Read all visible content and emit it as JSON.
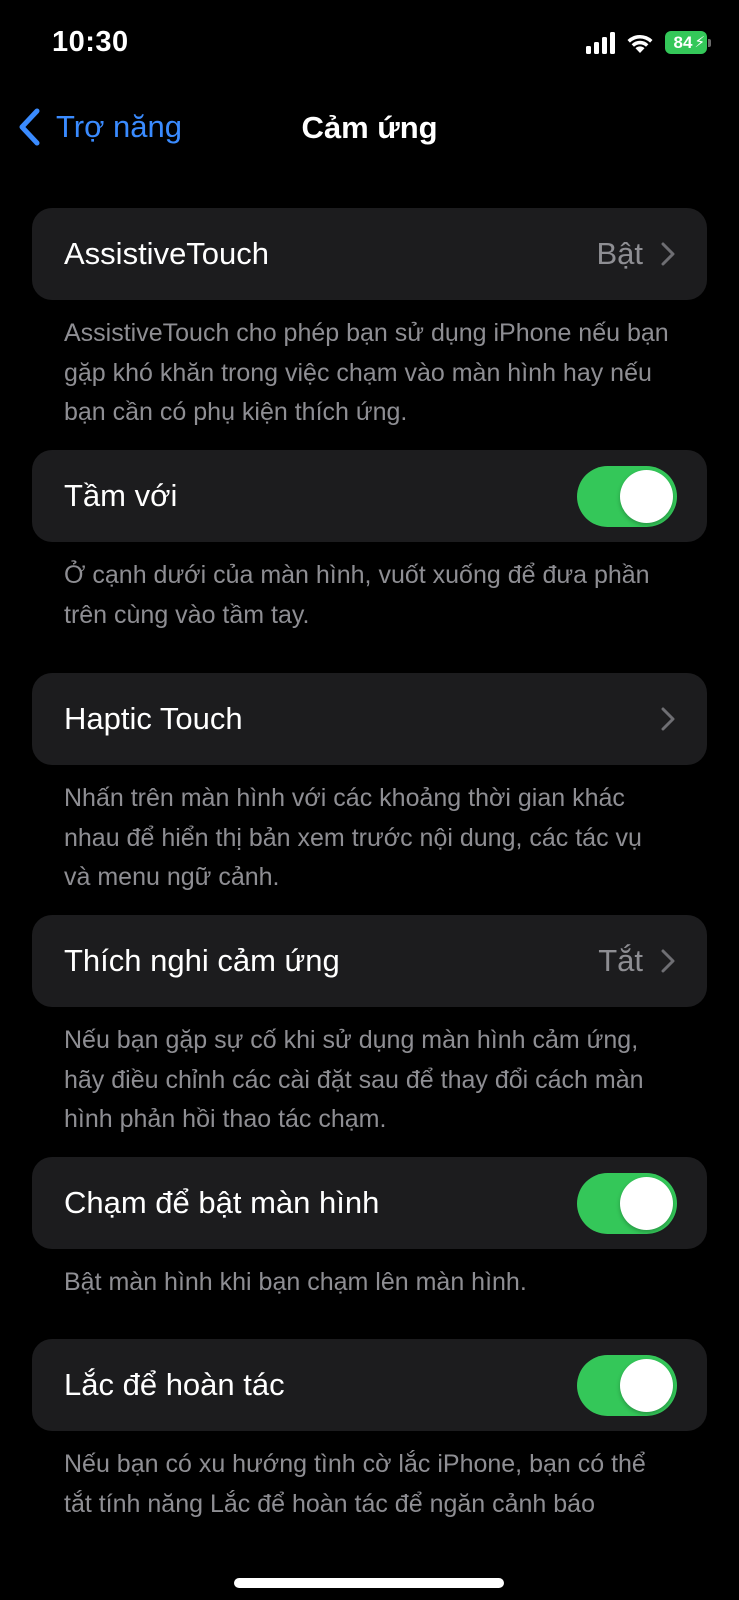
{
  "status_bar": {
    "time": "10:30",
    "battery": "84"
  },
  "nav": {
    "back_label": "Trợ năng",
    "title": "Cảm ứng"
  },
  "colors": {
    "accent": "#3a8bff",
    "toggle_on": "#34c759",
    "cell_bg": "#1c1c1e",
    "secondary_text": "#8e8e93"
  },
  "settings": [
    {
      "label": "AssistiveTouch",
      "value": "Bật",
      "footer": "AssistiveTouch cho phép bạn sử dụng iPhone nếu bạn gặp khó khăn trong việc chạm vào màn hình hay nếu bạn cần có phụ kiện thích ứng."
    },
    {
      "label": "Tầm với",
      "toggle": true,
      "footer": "Ở cạnh dưới của màn hình, vuốt xuống để đưa phần trên cùng vào tầm tay."
    },
    {
      "label": "Haptic Touch",
      "value": "",
      "footer": "Nhấn trên màn hình với các khoảng thời gian khác nhau để hiển thị bản xem trước nội dung, các tác vụ và menu ngữ cảnh."
    },
    {
      "label": "Thích nghi cảm ứng",
      "value": "Tắt",
      "footer": "Nếu bạn gặp sự cố khi sử dụng màn hình cảm ứng, hãy điều chỉnh các cài đặt sau để thay đổi cách màn hình phản hồi thao tác chạm."
    },
    {
      "label": "Chạm để bật màn hình",
      "toggle": true,
      "footer": "Bật màn hình khi bạn chạm lên màn hình."
    },
    {
      "label": "Lắc để hoàn tác",
      "toggle": true,
      "footer": "Nếu bạn có xu hướng tình cờ lắc iPhone, bạn có thể tắt tính năng Lắc để hoàn tác để ngăn cảnh báo"
    }
  ]
}
